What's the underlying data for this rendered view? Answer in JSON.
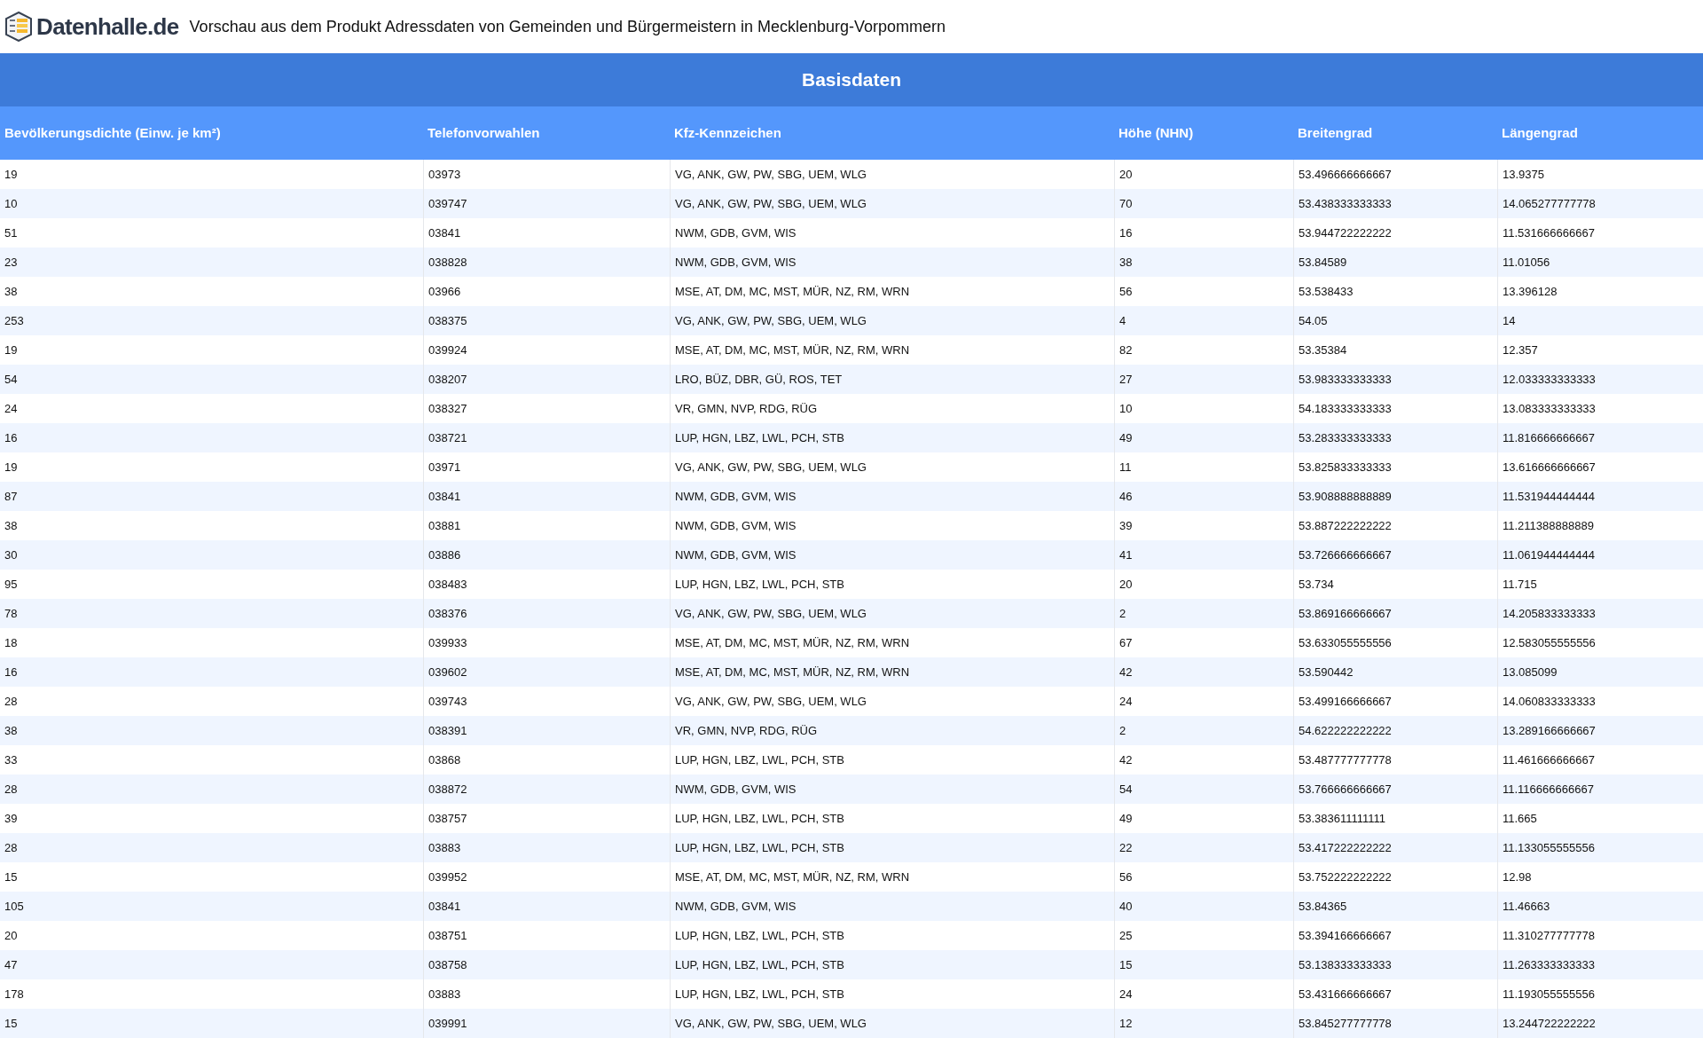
{
  "header": {
    "logo_text": "Datenhalle.de",
    "title": "Vorschau aus dem Produkt Adressdaten von Gemeinden und Bürgermeistern in Mecklenburg-Vorpommern"
  },
  "table": {
    "section_title": "Basisdaten",
    "columns": [
      "Bevölkerungsdichte (Einw. je km²)",
      "Telefonvorwahlen",
      "Kfz-Kennzeichen",
      "Höhe (NHN)",
      "Breitengrad",
      "Längengrad"
    ],
    "rows": [
      [
        "19",
        "03973",
        "VG, ANK, GW, PW, SBG, UEM, WLG",
        "20",
        "53.496666666667",
        "13.9375"
      ],
      [
        "10",
        "039747",
        "VG, ANK, GW, PW, SBG, UEM, WLG",
        "70",
        "53.438333333333",
        "14.065277777778"
      ],
      [
        "51",
        "03841",
        "NWM, GDB, GVM, WIS",
        "16",
        "53.944722222222",
        "11.531666666667"
      ],
      [
        "23",
        "038828",
        "NWM, GDB, GVM, WIS",
        "38",
        "53.84589",
        "11.01056"
      ],
      [
        "38",
        "03966",
        "MSE, AT, DM, MC, MST, MÜR, NZ, RM, WRN",
        "56",
        "53.538433",
        "13.396128"
      ],
      [
        "253",
        "038375",
        "VG, ANK, GW, PW, SBG, UEM, WLG",
        "4",
        "54.05",
        "14"
      ],
      [
        "19",
        "039924",
        "MSE, AT, DM, MC, MST, MÜR, NZ, RM, WRN",
        "82",
        "53.35384",
        "12.357"
      ],
      [
        "54",
        "038207",
        "LRO, BÜZ, DBR, GÜ, ROS, TET",
        "27",
        "53.983333333333",
        "12.033333333333"
      ],
      [
        "24",
        "038327",
        "VR, GMN, NVP, RDG, RÜG",
        "10",
        "54.183333333333",
        "13.083333333333"
      ],
      [
        "16",
        "038721",
        "LUP, HGN, LBZ, LWL, PCH, STB",
        "49",
        "53.283333333333",
        "11.816666666667"
      ],
      [
        "19",
        "03971",
        "VG, ANK, GW, PW, SBG, UEM, WLG",
        "11",
        "53.825833333333",
        "13.616666666667"
      ],
      [
        "87",
        "03841",
        "NWM, GDB, GVM, WIS",
        "46",
        "53.908888888889",
        "11.531944444444"
      ],
      [
        "38",
        "03881",
        "NWM, GDB, GVM, WIS",
        "39",
        "53.887222222222",
        "11.211388888889"
      ],
      [
        "30",
        "03886",
        "NWM, GDB, GVM, WIS",
        "41",
        "53.726666666667",
        "11.061944444444"
      ],
      [
        "95",
        "038483",
        "LUP, HGN, LBZ, LWL, PCH, STB",
        "20",
        "53.734",
        "11.715"
      ],
      [
        "78",
        "038376",
        "VG, ANK, GW, PW, SBG, UEM, WLG",
        "2",
        "53.869166666667",
        "14.205833333333"
      ],
      [
        "18",
        "039933",
        "MSE, AT, DM, MC, MST, MÜR, NZ, RM, WRN",
        "67",
        "53.633055555556",
        "12.583055555556"
      ],
      [
        "16",
        "039602",
        "MSE, AT, DM, MC, MST, MÜR, NZ, RM, WRN",
        "42",
        "53.590442",
        "13.085099"
      ],
      [
        "28",
        "039743",
        "VG, ANK, GW, PW, SBG, UEM, WLG",
        "24",
        "53.499166666667",
        "14.060833333333"
      ],
      [
        "38",
        "038391",
        "VR, GMN, NVP, RDG, RÜG",
        "2",
        "54.622222222222",
        "13.289166666667"
      ],
      [
        "33",
        "03868",
        "LUP, HGN, LBZ, LWL, PCH, STB",
        "42",
        "53.487777777778",
        "11.461666666667"
      ],
      [
        "28",
        "038872",
        "NWM, GDB, GVM, WIS",
        "54",
        "53.766666666667",
        "11.116666666667"
      ],
      [
        "39",
        "038757",
        "LUP, HGN, LBZ, LWL, PCH, STB",
        "49",
        "53.383611111111",
        "11.665"
      ],
      [
        "28",
        "03883",
        "LUP, HGN, LBZ, LWL, PCH, STB",
        "22",
        "53.417222222222",
        "11.133055555556"
      ],
      [
        "15",
        "039952",
        "MSE, AT, DM, MC, MST, MÜR, NZ, RM, WRN",
        "56",
        "53.752222222222",
        "12.98"
      ],
      [
        "105",
        "03841",
        "NWM, GDB, GVM, WIS",
        "40",
        "53.84365",
        "11.46663"
      ],
      [
        "20",
        "038751",
        "LUP, HGN, LBZ, LWL, PCH, STB",
        "25",
        "53.394166666667",
        "11.310277777778"
      ],
      [
        "47",
        "038758",
        "LUP, HGN, LBZ, LWL, PCH, STB",
        "15",
        "53.138333333333",
        "11.263333333333"
      ],
      [
        "178",
        "03883",
        "LUP, HGN, LBZ, LWL, PCH, STB",
        "24",
        "53.431666666667",
        "11.193055555556"
      ],
      [
        "15",
        "039991",
        "VG, ANK, GW, PW, SBG, UEM, WLG",
        "12",
        "53.845277777778",
        "13.244722222222"
      ]
    ]
  }
}
